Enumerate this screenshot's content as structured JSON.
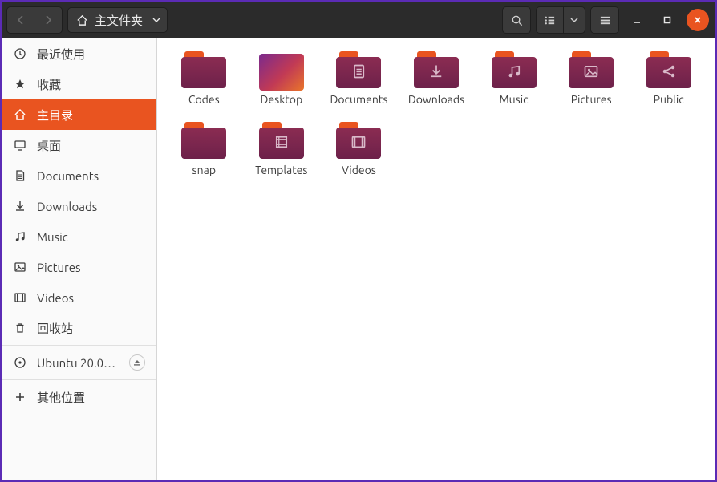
{
  "path": {
    "label": "主文件夹"
  },
  "sidebar": {
    "items": [
      {
        "id": "recent",
        "label": "最近使用",
        "icon": "clock"
      },
      {
        "id": "starred",
        "label": "收藏",
        "icon": "star"
      },
      {
        "id": "home",
        "label": "主目录",
        "icon": "home",
        "active": true
      },
      {
        "id": "desktop",
        "label": "桌面",
        "icon": "desktop"
      },
      {
        "id": "documents",
        "label": "Documents",
        "icon": "document"
      },
      {
        "id": "downloads",
        "label": "Downloads",
        "icon": "download"
      },
      {
        "id": "music",
        "label": "Music",
        "icon": "music"
      },
      {
        "id": "pictures",
        "label": "Pictures",
        "icon": "picture"
      },
      {
        "id": "videos",
        "label": "Videos",
        "icon": "video"
      },
      {
        "id": "trash",
        "label": "回收站",
        "icon": "trash"
      }
    ],
    "mount": {
      "label": "Ubuntu 20.0…",
      "icon": "disc",
      "eject": true
    },
    "other": {
      "label": "其他位置",
      "icon": "plus"
    }
  },
  "folders": [
    {
      "name": "Codes",
      "glyph": ""
    },
    {
      "name": "Desktop",
      "type": "desktop"
    },
    {
      "name": "Documents",
      "glyph": "doc"
    },
    {
      "name": "Downloads",
      "glyph": "download"
    },
    {
      "name": "Music",
      "glyph": "music"
    },
    {
      "name": "Pictures",
      "glyph": "picture"
    },
    {
      "name": "Public",
      "glyph": "share"
    },
    {
      "name": "snap",
      "glyph": ""
    },
    {
      "name": "Templates",
      "glyph": "template"
    },
    {
      "name": "Videos",
      "glyph": "video"
    }
  ]
}
